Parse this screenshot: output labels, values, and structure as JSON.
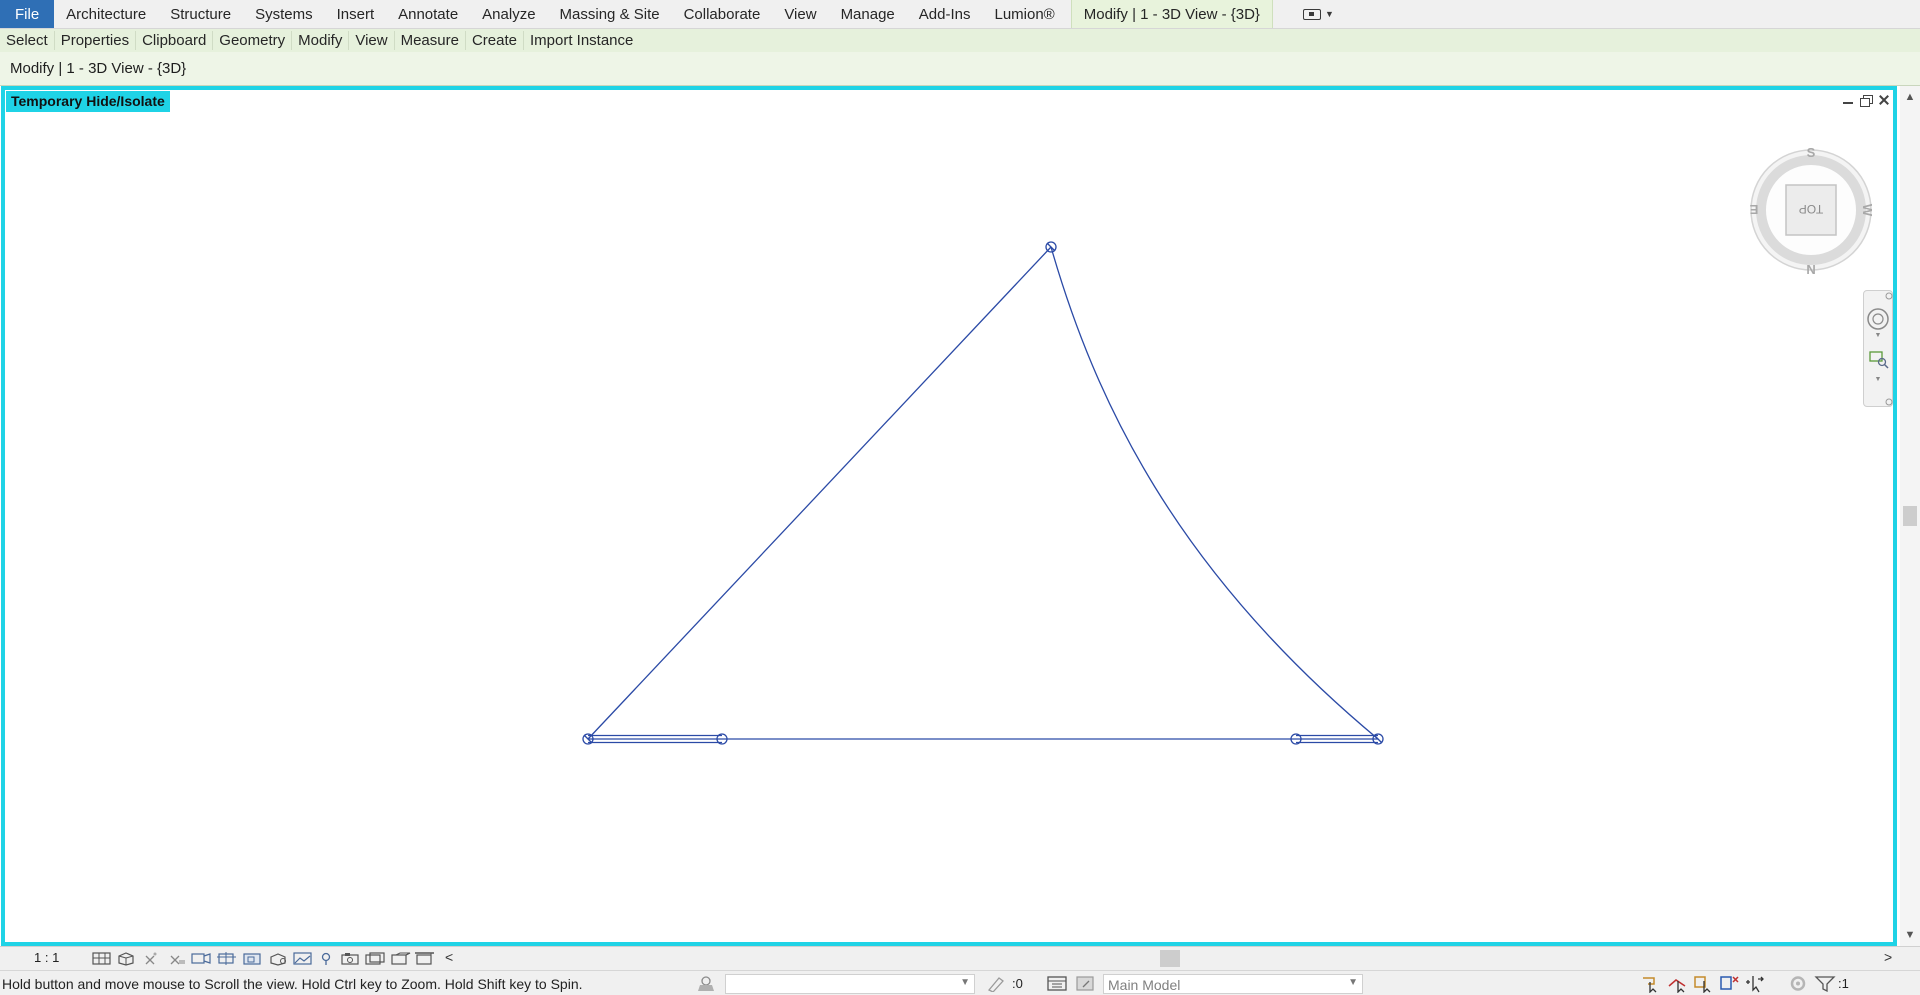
{
  "ribbon": {
    "tabs": [
      {
        "label": "File"
      },
      {
        "label": "Architecture"
      },
      {
        "label": "Structure"
      },
      {
        "label": "Systems"
      },
      {
        "label": "Insert"
      },
      {
        "label": "Annotate"
      },
      {
        "label": "Analyze"
      },
      {
        "label": "Massing & Site"
      },
      {
        "label": "Collaborate"
      },
      {
        "label": "View"
      },
      {
        "label": "Manage"
      },
      {
        "label": "Add-Ins"
      },
      {
        "label": "Lumion®"
      }
    ],
    "context_tab": "Modify | 1 - 3D View - {3D}"
  },
  "panels": [
    "Select",
    "Properties",
    "Clipboard",
    "Geometry",
    "Modify",
    "View",
    "Measure",
    "Create",
    "Import Instance"
  ],
  "options_bar": {
    "label": "Modify | 1 - 3D View - {3D}"
  },
  "view": {
    "banner": "Temporary Hide/Isolate",
    "viewcube": {
      "face": "TOP",
      "compass": {
        "north": "N",
        "south": "S",
        "east": "E",
        "west": "W"
      }
    }
  },
  "view_control": {
    "scale": "1 : 1"
  },
  "status": {
    "message": "Hold button and move mouse to Scroll the view. Hold Ctrl key to Zoom. Hold Shift key to Spin.",
    "selection_count": ":0",
    "workset": "Main Model",
    "filter_count": ":1"
  },
  "colors": {
    "accent_cyan": "#1fd3e6",
    "line_blue": "#2b4aa6",
    "file_tab": "#2f6fb5",
    "context_green": "#e8f3dc"
  }
}
